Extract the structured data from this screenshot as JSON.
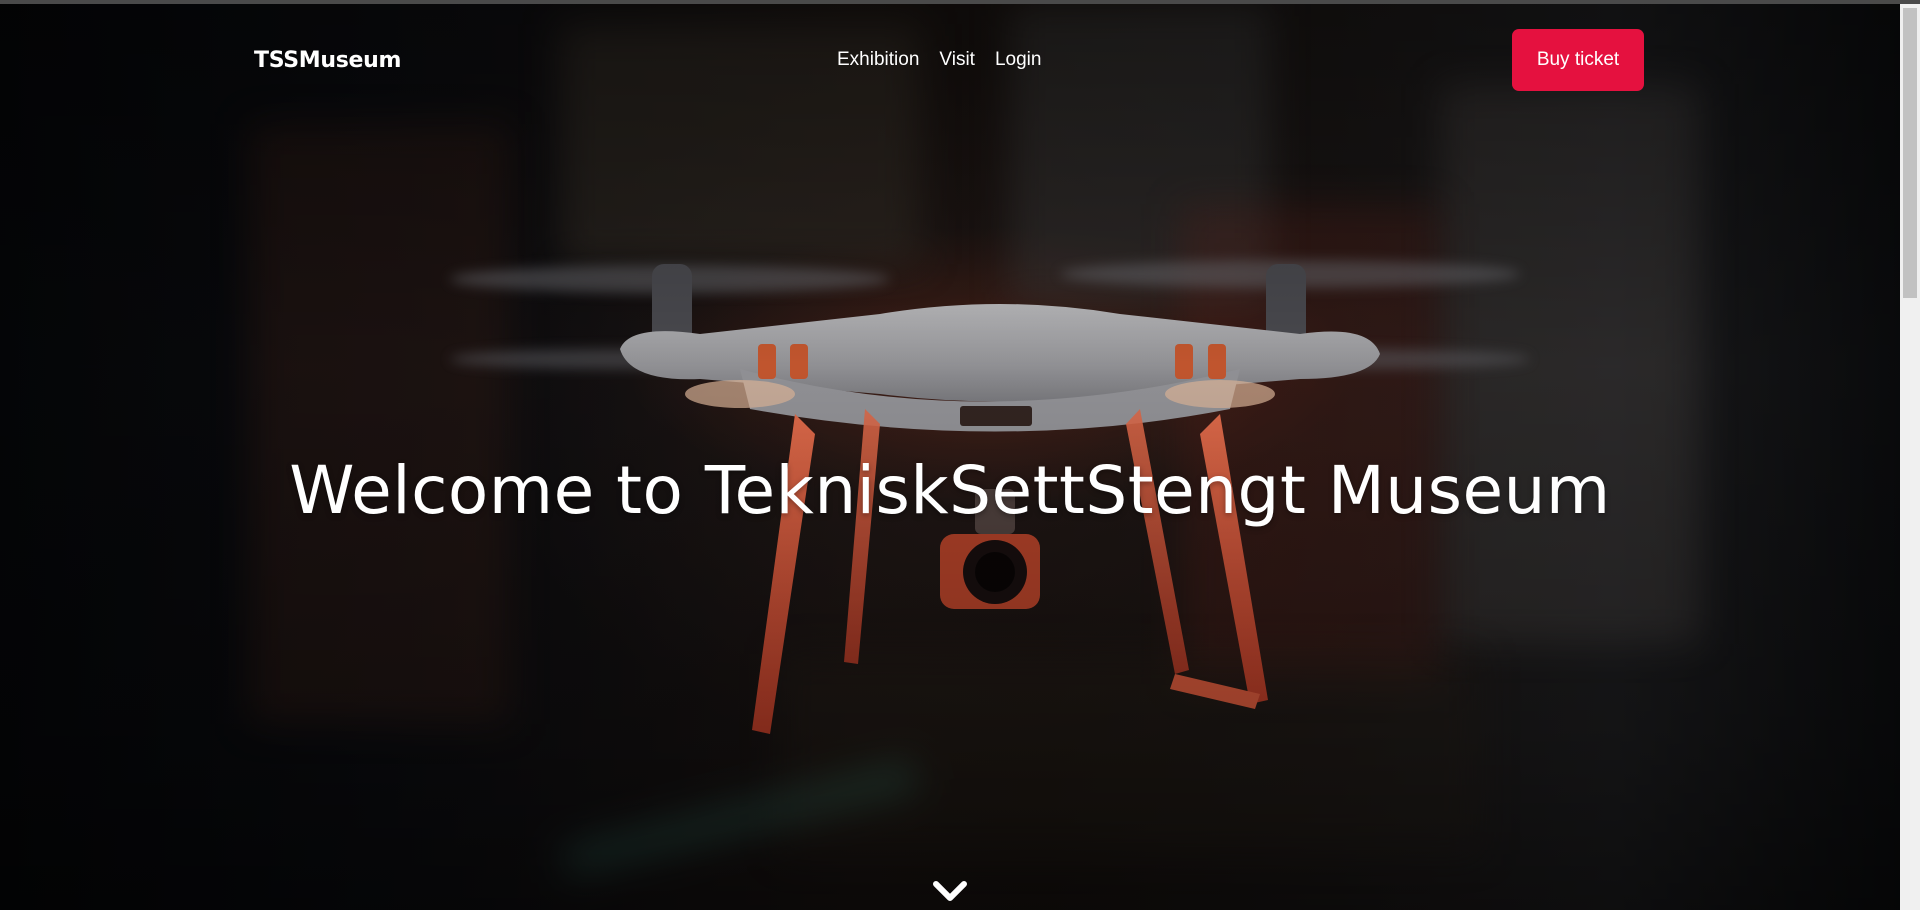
{
  "brand": {
    "logo": "TSSMuseum"
  },
  "nav": {
    "items": [
      {
        "label": "Exhibition"
      },
      {
        "label": "Visit"
      },
      {
        "label": "Login"
      }
    ],
    "cta_label": "Buy ticket"
  },
  "hero": {
    "headline": "Welcome to TekniskSettStengt Museum",
    "scroll_icon": "chevron-down-icon",
    "image_subject": "white quadcopter drone with orange lighting"
  },
  "colors": {
    "accent": "#e5113f",
    "text": "#ffffff",
    "background": "#050608"
  }
}
